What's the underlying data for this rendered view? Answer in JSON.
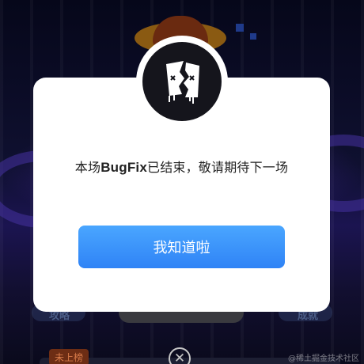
{
  "background": {
    "tabs": {
      "left": "攻略",
      "right": "成就"
    },
    "rank_badge": "未上榜",
    "watermark": "@稀土掘金技术社区",
    "close_icon": "close-circle-icon"
  },
  "modal": {
    "icon": "broken-paper-icon",
    "message_prefix": "本场",
    "message_brand": "BugFix",
    "message_suffix": "已结束，敬请期待下一场",
    "confirm_label": "我知道啦"
  },
  "colors": {
    "accent": "#2f83f6",
    "modal_bg": "#ffffff",
    "logo_bg": "#15151c"
  }
}
